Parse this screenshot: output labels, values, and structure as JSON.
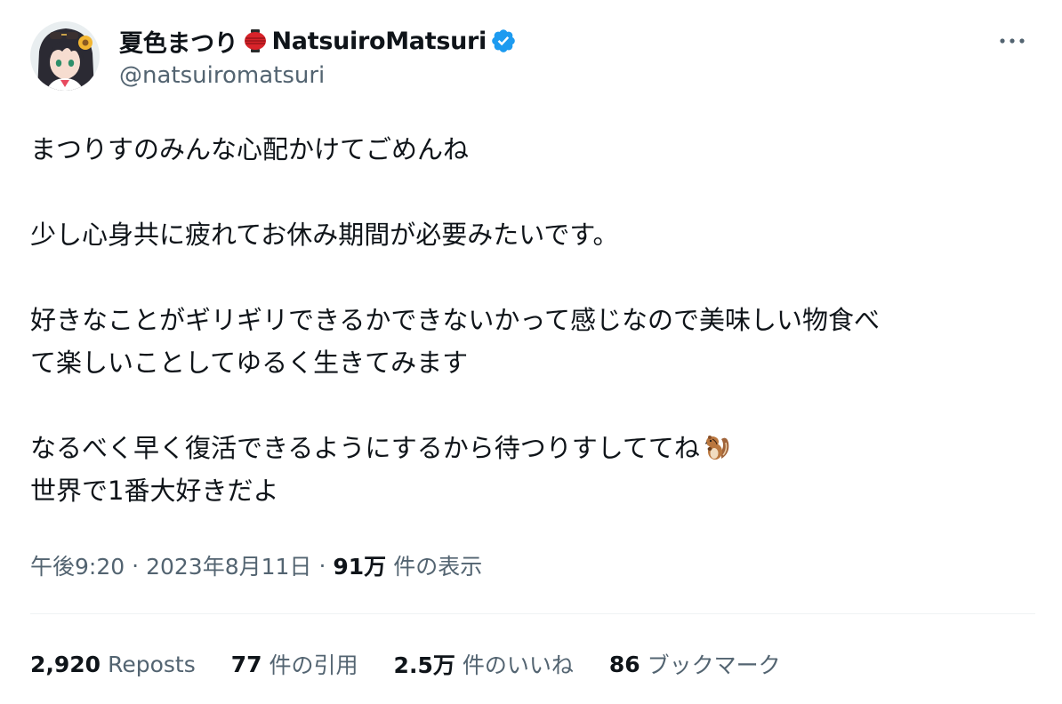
{
  "author": {
    "display_name": "夏色まつり",
    "display_name_en": "NatsuiroMatsuri",
    "handle": "@natsuiromatsuri",
    "avatar_icon": "avatar-image",
    "name_emoji_icon": "red-lantern-icon",
    "verified_icon": "verified-badge-icon"
  },
  "more_menu_icon": "more-horizontal-icon",
  "tweet": {
    "lines": {
      "l1": "まつりすのみんな心配かけてごめんね",
      "l2": "少し心身共に疲れてお休み期間が必要みたいです。",
      "l3": "好きなことがギリギリできるかできないかって感じなので美味しい物食べ",
      "l4": "て楽しいことしてゆるく生きてみます",
      "l5": "なるべく早く復活できるようにするから待つりすしててね",
      "l6": "世界で1番大好きだよ"
    },
    "trailing_emoji_icon": "chipmunk-icon"
  },
  "meta": {
    "time": "午後9:20",
    "separator": "·",
    "date": "2023年8月11日",
    "views_count": "91万",
    "views_label": "件の表示"
  },
  "stats": {
    "reposts": {
      "count": "2,920",
      "label": "Reposts"
    },
    "quotes": {
      "count": "77",
      "label": "件の引用"
    },
    "likes": {
      "count": "2.5万",
      "label": "件のいいね"
    },
    "bookmarks": {
      "count": "86",
      "label": "ブックマーク"
    }
  },
  "colors": {
    "text_primary": "#0f1419",
    "text_secondary": "#536471",
    "verified_blue": "#1d9bf0",
    "divider": "#eff3f4"
  }
}
